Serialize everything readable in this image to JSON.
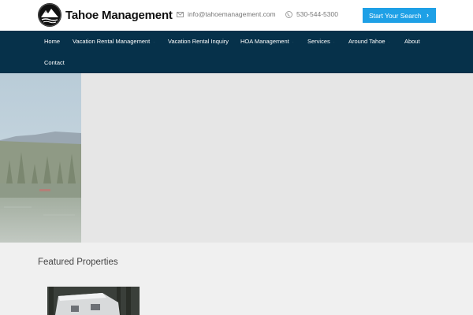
{
  "brand": {
    "name": "Tahoe Management",
    "logo_icon": "mountain-lake-circle-icon"
  },
  "header": {
    "email": "info@tahoemanagement.com",
    "phone": "530-544-5300",
    "cta_label": "Start Your Search",
    "email_icon": "envelope-icon",
    "phone_icon": "phone-icon",
    "cta_icon": "chevron-right-icon"
  },
  "nav": {
    "items": [
      {
        "label": "Home"
      },
      {
        "label": "Vacation Rental Management"
      },
      {
        "label": "Vacation Rental Inquiry"
      },
      {
        "label": "HOA Management"
      },
      {
        "label": "Services"
      },
      {
        "label": "Around Tahoe"
      },
      {
        "label": "About"
      },
      {
        "label": "Contact"
      }
    ]
  },
  "sections": {
    "featured_title": "Featured Properties"
  },
  "colors": {
    "cta": "#1ea0e6",
    "nav_background": "#06314a",
    "hero_background": "#e6e6e6",
    "page_background": "#f0f0f0"
  }
}
